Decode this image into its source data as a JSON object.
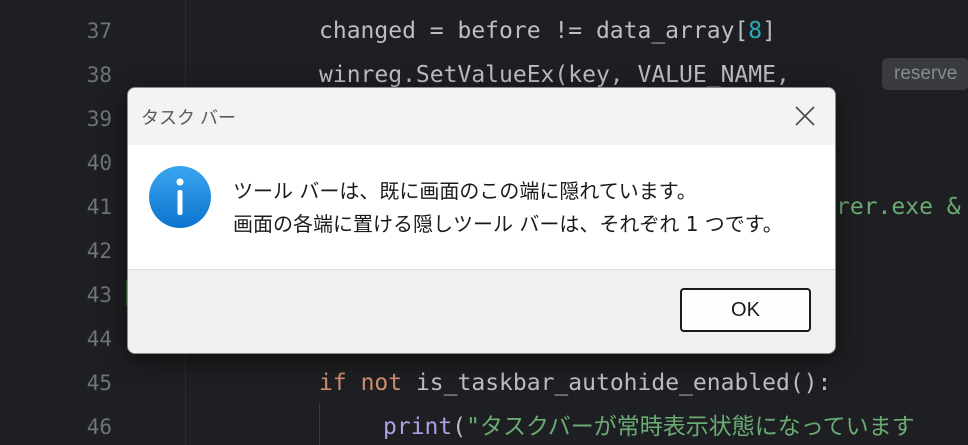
{
  "editor": {
    "line_numbers": [
      "37",
      "38",
      "39",
      "40",
      "41",
      "42",
      "43",
      "44",
      "45",
      "46"
    ],
    "lines": {
      "l37": {
        "a": "changed = before != data_array[",
        "num": "8",
        "b": "]"
      },
      "l38": {
        "a": "winreg.SetValueEx(key, VALUE_NAME, ",
        "hint": "reserve"
      },
      "l41": {
        "str": "rer.exe &"
      },
      "l45": {
        "kw1": "if",
        "sp1": " ",
        "kw2": "not",
        "rest": " is_taskbar_autohide_enabled():"
      },
      "l46": {
        "fn": "print",
        "paren": "(",
        "str": "\"タスクバーが常時表示状態になっています"
      }
    }
  },
  "dialog": {
    "title": "タスク バー",
    "message_line1": "ツール バーは、既に画面のこの端に隠れています。",
    "message_line2": "画面の各端に置ける隠しツール バーは、それぞれ 1 つです。",
    "ok_label": "OK",
    "icon": "info-icon",
    "close_icon": "close-icon"
  },
  "colors": {
    "editor_bg": "#1e1f22",
    "info_icon": "#1a8de0",
    "string": "#6aab73",
    "keyword": "#cf8e6d",
    "number": "#2aacb8"
  }
}
